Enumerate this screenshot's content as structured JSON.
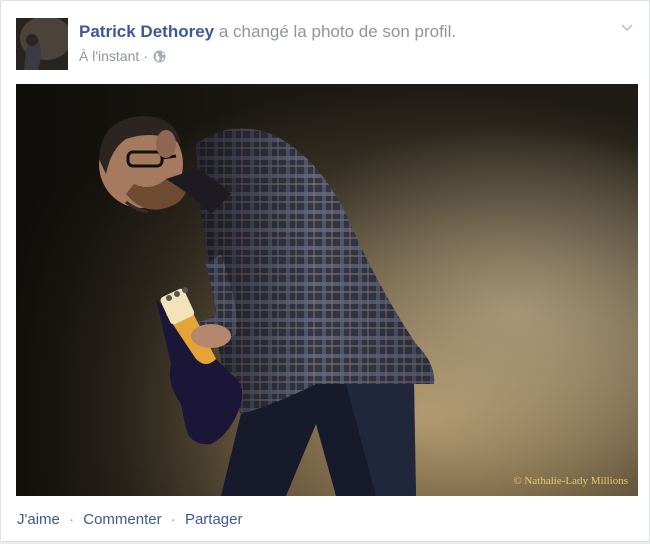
{
  "post": {
    "author": "Patrick Dethorey",
    "action_text": "a changé la photo de son profil.",
    "timestamp": "À l'instant",
    "separator": "·",
    "privacy_icon": "globe-icon",
    "options_icon": "chevron-down-icon"
  },
  "photo": {
    "watermark": "© Nathalie-Lady Millions"
  },
  "actions": {
    "like": "J'aime",
    "comment": "Commenter",
    "share": "Partager",
    "separator": "·"
  },
  "colors": {
    "link": "#3b5998",
    "meta": "#90949c",
    "watermark": "#e8c96a"
  }
}
